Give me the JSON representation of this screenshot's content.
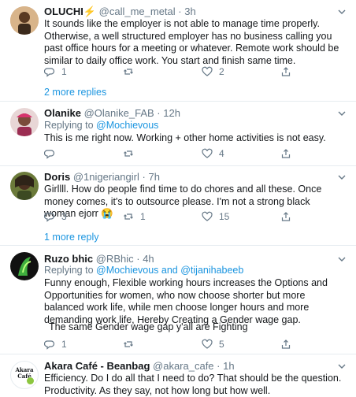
{
  "tweets": [
    {
      "name": "OLUCHI⚡",
      "handle": "@call_me_metal",
      "time": "3h",
      "text": "It sounds like the employer is not able to manage time properly. Otherwise, a well structured employer has no business calling you past office hours for a meeting or whatever. Remote work should be similar to daily office work. You start and finish same time.",
      "replies": "1",
      "retweets": "",
      "likes": "2",
      "more_replies": "2 more replies"
    },
    {
      "name": "Olanike",
      "handle": "@Olanike_FAB",
      "time": "12h",
      "replying_label": "Replying to",
      "replying_to": "@Mochievous",
      "text": "This is me right now. Working + other home activities is not easy.",
      "replies": "",
      "retweets": "",
      "likes": "4"
    },
    {
      "name": "Doris",
      "handle": "@1nigeriangirl",
      "time": "7h",
      "text": "Girllll. How do people find time to do chores and all these. Once money comes, it's to outsource please. I'm not a strong black woman ejorr 😭",
      "replies": "3",
      "retweets": "1",
      "likes": "15",
      "more_replies": "1 more reply"
    },
    {
      "name": "Ruzo bhic",
      "handle": "@RBhic",
      "time": "4h",
      "replying_label": "Replying to",
      "replying_to": "@Mochievous and @tijanihabeeb",
      "text": "Funny enough, Flexible working hours increases the Options and Opportunities for women, who now choose shorter but more balanced work life, while men choose longer hours and more demanding work life, Hereby Creating a Gender wage gap.",
      "text2": "The same Gender wage gap y'all are Fighting",
      "replies": "1",
      "retweets": "",
      "likes": "5"
    },
    {
      "name": "Akara Café - Beanbag",
      "handle": "@akara_cafe",
      "time": "1h",
      "text": "Efficiency. Do I do all that I need to do? That should be the question. Productivity. As they say, not how long but how well.",
      "avatar_text_1": "Akara",
      "avatar_text_2": "Café"
    }
  ],
  "separator": "·",
  "colors": {
    "link": "#1b95e0",
    "muted": "#657786",
    "divider": "#e6ecf0"
  }
}
